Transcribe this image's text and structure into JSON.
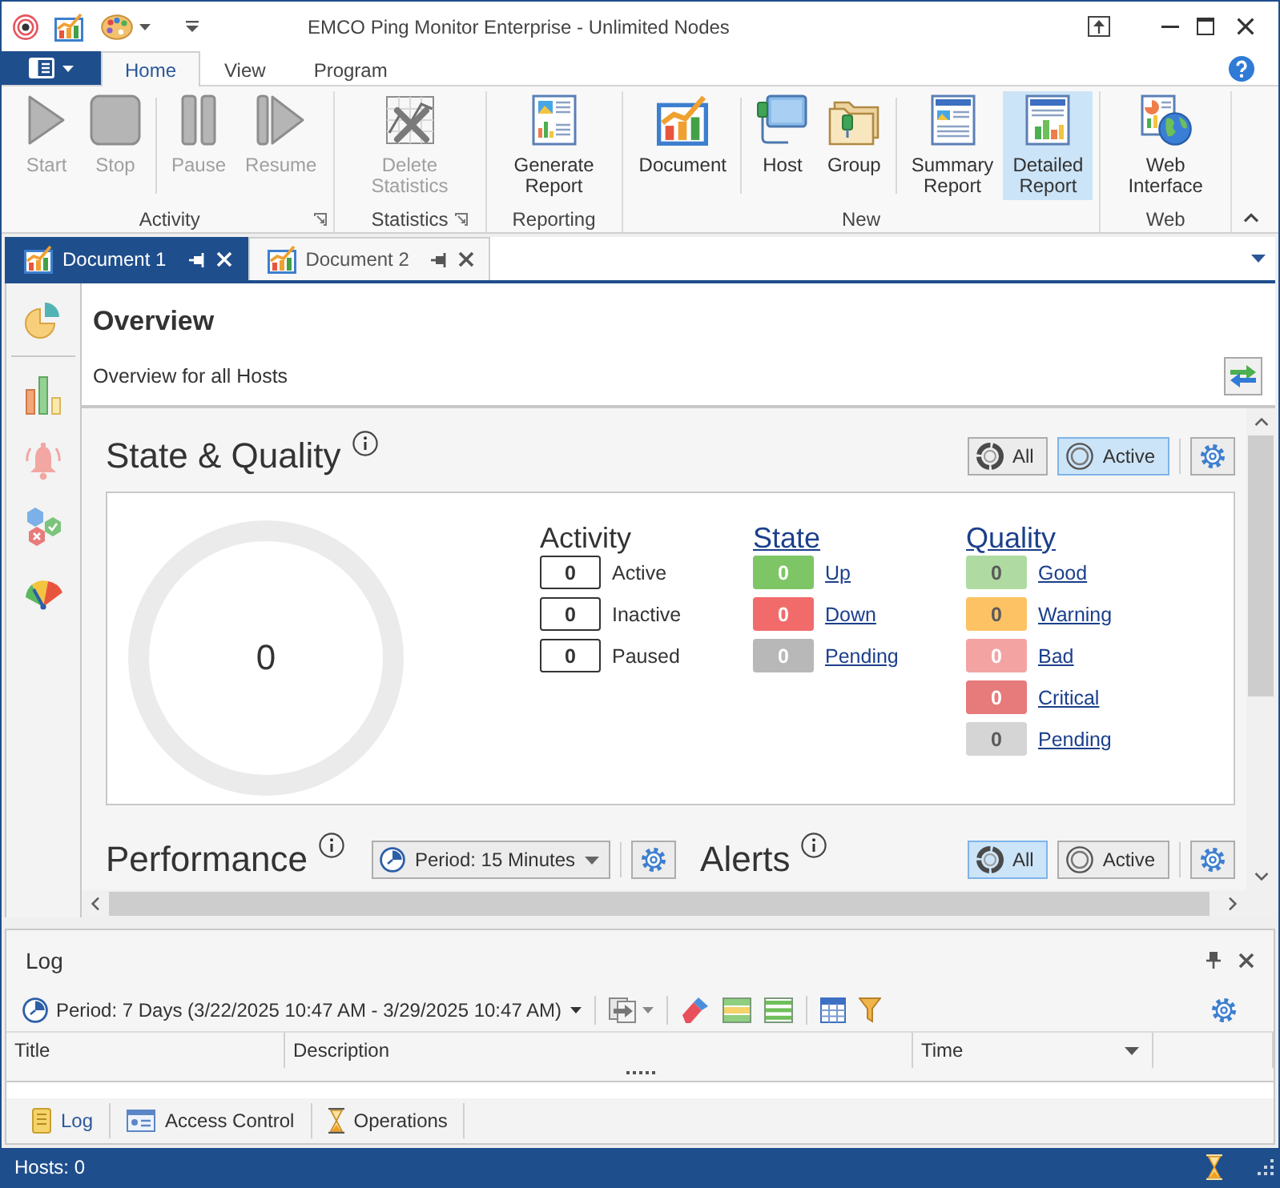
{
  "window": {
    "title": "EMCO Ping Monitor Enterprise - Unlimited Nodes"
  },
  "ribbon": {
    "tabs": [
      {
        "label": "Home",
        "selected": true
      },
      {
        "label": "View",
        "selected": false
      },
      {
        "label": "Program",
        "selected": false
      }
    ],
    "groups": [
      {
        "label": "Activity",
        "launcher": true,
        "sections": [
          [
            {
              "kind": "start",
              "label": "Start",
              "disabled": true,
              "highlighted": false
            },
            {
              "kind": "stop",
              "label": "Stop",
              "disabled": true,
              "highlighted": false
            }
          ],
          [
            {
              "kind": "pause",
              "label": "Pause",
              "disabled": true,
              "highlighted": false
            },
            {
              "kind": "resume",
              "label": "Resume",
              "disabled": true,
              "highlighted": false
            }
          ]
        ]
      },
      {
        "label": "Statistics",
        "launcher": true,
        "sections": [
          [
            {
              "kind": "erase",
              "label": "Delete Statistics",
              "disabled": true,
              "highlighted": false
            }
          ]
        ]
      },
      {
        "label": "Reporting",
        "launcher": false,
        "sections": [
          [
            {
              "kind": "generate",
              "label": "Generate Report",
              "disabled": false,
              "highlighted": false
            }
          ]
        ]
      },
      {
        "label": "New",
        "launcher": false,
        "sections": [
          [
            {
              "kind": "document",
              "label": "Document",
              "disabled": false,
              "highlighted": false
            }
          ],
          [
            {
              "kind": "host",
              "label": "Host",
              "disabled": false,
              "highlighted": false
            },
            {
              "kind": "group",
              "label": "Group",
              "disabled": false,
              "highlighted": false
            }
          ],
          [
            {
              "kind": "summary",
              "label": "Summary Report",
              "disabled": false,
              "highlighted": false
            },
            {
              "kind": "detailed",
              "label": "Detailed Report",
              "disabled": false,
              "highlighted": true
            }
          ]
        ]
      },
      {
        "label": "Web",
        "launcher": false,
        "sections": [
          [
            {
              "kind": "web",
              "label": "Web Interface",
              "disabled": false,
              "highlighted": false
            }
          ]
        ]
      }
    ]
  },
  "doc_tabs": [
    {
      "label": "Document 1",
      "selected": true
    },
    {
      "label": "Document 2",
      "selected": false
    }
  ],
  "overview": {
    "title": "Overview",
    "subtitle": "Overview for all Hosts"
  },
  "state_quality": {
    "title": "State & Quality",
    "filters": [
      {
        "label": "All",
        "selected": false
      },
      {
        "label": "Active",
        "selected": true
      }
    ],
    "total": "0",
    "activity": {
      "title": "Activity",
      "items": [
        {
          "count": "0",
          "label": "Active"
        },
        {
          "count": "0",
          "label": "Inactive"
        },
        {
          "count": "0",
          "label": "Paused"
        }
      ]
    },
    "state": {
      "title": "State",
      "items": [
        {
          "count": "0",
          "label": "Up",
          "color": "#7ec566"
        },
        {
          "count": "0",
          "label": "Down",
          "color": "#f26b6b"
        },
        {
          "count": "0",
          "label": "Pending",
          "color": "#b8b8b8"
        }
      ]
    },
    "quality": {
      "title": "Quality",
      "items": [
        {
          "count": "0",
          "label": "Good",
          "color": "#afdba2"
        },
        {
          "count": "0",
          "label": "Warning",
          "color": "#fdc263"
        },
        {
          "count": "0",
          "label": "Bad",
          "color": "#f4a3a3"
        },
        {
          "count": "0",
          "label": "Critical",
          "color": "#e77a7a"
        },
        {
          "count": "0",
          "label": "Pending",
          "color": "#d5d5d5"
        }
      ]
    }
  },
  "performance": {
    "title": "Performance",
    "period": "Period: 15 Minutes"
  },
  "alerts": {
    "title": "Alerts",
    "filters": [
      {
        "label": "All",
        "selected": true
      },
      {
        "label": "Active",
        "selected": false
      }
    ]
  },
  "log": {
    "title": "Log",
    "period": "Period: 7 Days (3/22/2025 10:47 AM - 3/29/2025 10:47 AM)",
    "columns": [
      {
        "label": "Title",
        "sorted": false
      },
      {
        "label": "Description",
        "sorted": false
      },
      {
        "label": "Time",
        "sorted": true
      }
    ],
    "tabs": [
      {
        "kind": "log",
        "label": "Log",
        "selected": true
      },
      {
        "kind": "access",
        "label": "Access Control",
        "selected": false
      },
      {
        "kind": "operations",
        "label": "Operations",
        "selected": false
      }
    ]
  },
  "status_bar": {
    "text": "Hosts: 0"
  }
}
